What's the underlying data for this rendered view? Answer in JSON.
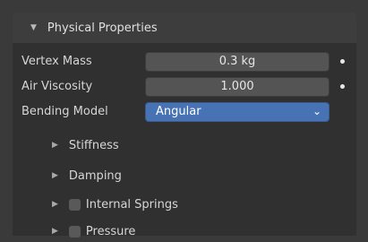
{
  "panel": {
    "header": {
      "title": "Physical Properties",
      "icon": "triangle-down-icon"
    },
    "fields": [
      {
        "label": "Vertex Mass",
        "value": "0.3 kg"
      },
      {
        "label": "Air Viscosity",
        "value": "1.000"
      }
    ],
    "bending_model": {
      "label": "Bending Model",
      "selected": "Angular"
    },
    "subpanels": [
      {
        "label": "Stiffness",
        "checkbox": false
      },
      {
        "label": "Damping",
        "checkbox": false
      },
      {
        "label": "Internal Springs",
        "checkbox": true,
        "checked": false
      },
      {
        "label": "Pressure",
        "checkbox": true,
        "checked": false
      }
    ]
  },
  "colors": {
    "background": "#303030",
    "header": "#3d3d3d",
    "field": "#545454",
    "accent": "#4772b3"
  }
}
